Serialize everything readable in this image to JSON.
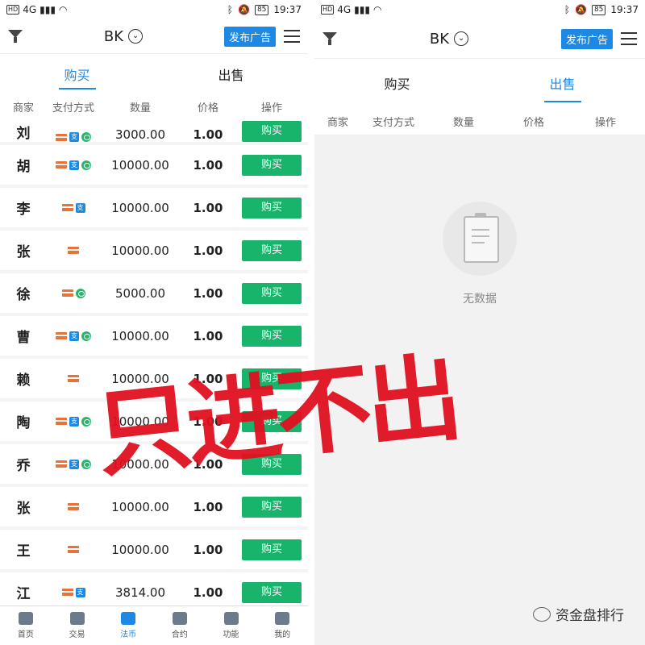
{
  "status": {
    "time": "19:37",
    "battery": "85",
    "hd": "HD",
    "signal": "4G"
  },
  "header": {
    "title": "BK",
    "publish_label": "发布广告"
  },
  "tabs": [
    {
      "label": "购买"
    },
    {
      "label": "出售"
    }
  ],
  "columns": [
    "商家",
    "支付方式",
    "数量",
    "价格",
    "操作"
  ],
  "action_label": "购买",
  "rows": [
    {
      "name": "刘",
      "pays": [
        "card",
        "alipay",
        "wechat"
      ],
      "qty": "3000.00",
      "price": "1.00"
    },
    {
      "name": "胡",
      "pays": [
        "card",
        "alipay",
        "wechat"
      ],
      "qty": "10000.00",
      "price": "1.00"
    },
    {
      "name": "李",
      "pays": [
        "card",
        "alipay"
      ],
      "qty": "10000.00",
      "price": "1.00"
    },
    {
      "name": "张",
      "pays": [
        "card"
      ],
      "qty": "10000.00",
      "price": "1.00"
    },
    {
      "name": "徐",
      "pays": [
        "card",
        "wechat"
      ],
      "qty": "5000.00",
      "price": "1.00"
    },
    {
      "name": "曹",
      "pays": [
        "card",
        "alipay",
        "wechat"
      ],
      "qty": "10000.00",
      "price": "1.00"
    },
    {
      "name": "赖",
      "pays": [
        "card"
      ],
      "qty": "10000.00",
      "price": "1.00"
    },
    {
      "name": "陶",
      "pays": [
        "card",
        "alipay",
        "wechat"
      ],
      "qty": "10000.00",
      "price": "1.00"
    },
    {
      "name": "乔",
      "pays": [
        "card",
        "alipay",
        "wechat"
      ],
      "qty": "10000.00",
      "price": "1.00"
    },
    {
      "name": "张",
      "pays": [
        "card"
      ],
      "qty": "10000.00",
      "price": "1.00"
    },
    {
      "name": "王",
      "pays": [
        "card"
      ],
      "qty": "10000.00",
      "price": "1.00"
    },
    {
      "name": "江",
      "pays": [
        "card",
        "alipay"
      ],
      "qty": "3814.00",
      "price": "1.00"
    }
  ],
  "bottom_nav": [
    {
      "label": "首页",
      "icon": "home-icon"
    },
    {
      "label": "交易",
      "icon": "candlestick-icon"
    },
    {
      "label": "法币",
      "icon": "fiat-icon",
      "active": true
    },
    {
      "label": "合约",
      "icon": "contract-icon"
    },
    {
      "label": "功能",
      "icon": "function-icon"
    },
    {
      "label": "我的",
      "icon": "user-icon"
    }
  ],
  "empty_text": "无数据",
  "overlay_text": "只进不出",
  "watermark": "资金盘排行",
  "colors": {
    "accent": "#1e88e5",
    "buy": "#19b46b",
    "overlay": "#e01020"
  }
}
